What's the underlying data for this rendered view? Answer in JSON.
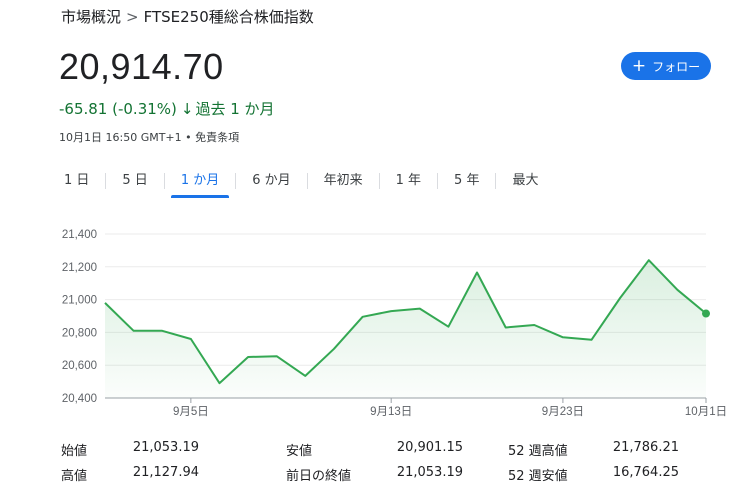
{
  "breadcrumb": {
    "root": "市場概況",
    "separator": ">",
    "current": "FTSE250種総合株価指数"
  },
  "price": "20,914.70",
  "follow_label": "フォロー",
  "change": {
    "value": "-65.81 (-0.31%)",
    "arrow": "↓",
    "period": "過去 1 か月"
  },
  "meta": "10月1日 16:50 GMT+1 • 免責条項",
  "tabs": [
    "1 日",
    "5 日",
    "1 か月",
    "6 か月",
    "年初来",
    "1 年",
    "5 年",
    "最大"
  ],
  "active_tab": "1 か月",
  "colors": {
    "line": "#34a853",
    "accent": "#1a73e8",
    "positive": "#137333"
  },
  "chart_data": {
    "type": "area",
    "title": "",
    "xlabel": "",
    "ylabel": "",
    "ylim": [
      20400,
      21400
    ],
    "yticks": [
      "21,400",
      "21,200",
      "21,000",
      "20,800",
      "20,600",
      "20,400"
    ],
    "x_tick_labels": [
      "9月5日",
      "9月13日",
      "9月23日",
      "10月1日"
    ],
    "grid": true,
    "series": [
      {
        "values": [
          20980,
          20810,
          20810,
          20760,
          20490,
          20650,
          20655,
          20535,
          20700,
          20895,
          20930,
          20945,
          20835,
          21165,
          20830,
          20845,
          20770,
          20755,
          21010,
          21240,
          21060,
          20915
        ]
      }
    ]
  },
  "stats": {
    "rows": [
      [
        {
          "label": "始値",
          "value": "21,053.19"
        },
        {
          "label": "安値",
          "value": "20,901.15"
        },
        {
          "label": "52 週高値",
          "value": "21,786.21"
        }
      ],
      [
        {
          "label": "高値",
          "value": "21,127.94"
        },
        {
          "label": "前日の終値",
          "value": "21,053.19"
        },
        {
          "label": "52 週安値",
          "value": "16,764.25"
        }
      ]
    ]
  }
}
